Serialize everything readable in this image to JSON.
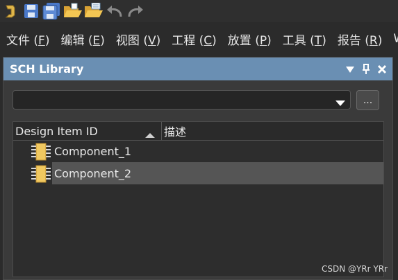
{
  "menu": [
    {
      "name": "文件 ",
      "key": "F"
    },
    {
      "name": "编辑 ",
      "key": "E"
    },
    {
      "name": "视图 ",
      "key": "V"
    },
    {
      "name": "工程 ",
      "key": "C"
    },
    {
      "name": "放置 ",
      "key": "P"
    },
    {
      "name": "工具 ",
      "key": "T"
    },
    {
      "name": "报告 ",
      "key": "R"
    },
    {
      "name": "W",
      "key": ""
    }
  ],
  "panel": {
    "title": "SCH Library",
    "combo_value": "",
    "dots_label": "...",
    "columns": [
      "Design Item ID",
      "描述"
    ],
    "rows": [
      {
        "id": "Component_1",
        "desc": ""
      },
      {
        "id": "Component_2",
        "desc": ""
      }
    ]
  },
  "watermark": "CSDN @YRr YRr",
  "colors": {
    "header": "#6a8fb3",
    "selected_row": "#555555",
    "component_icon": "#f0c860"
  }
}
